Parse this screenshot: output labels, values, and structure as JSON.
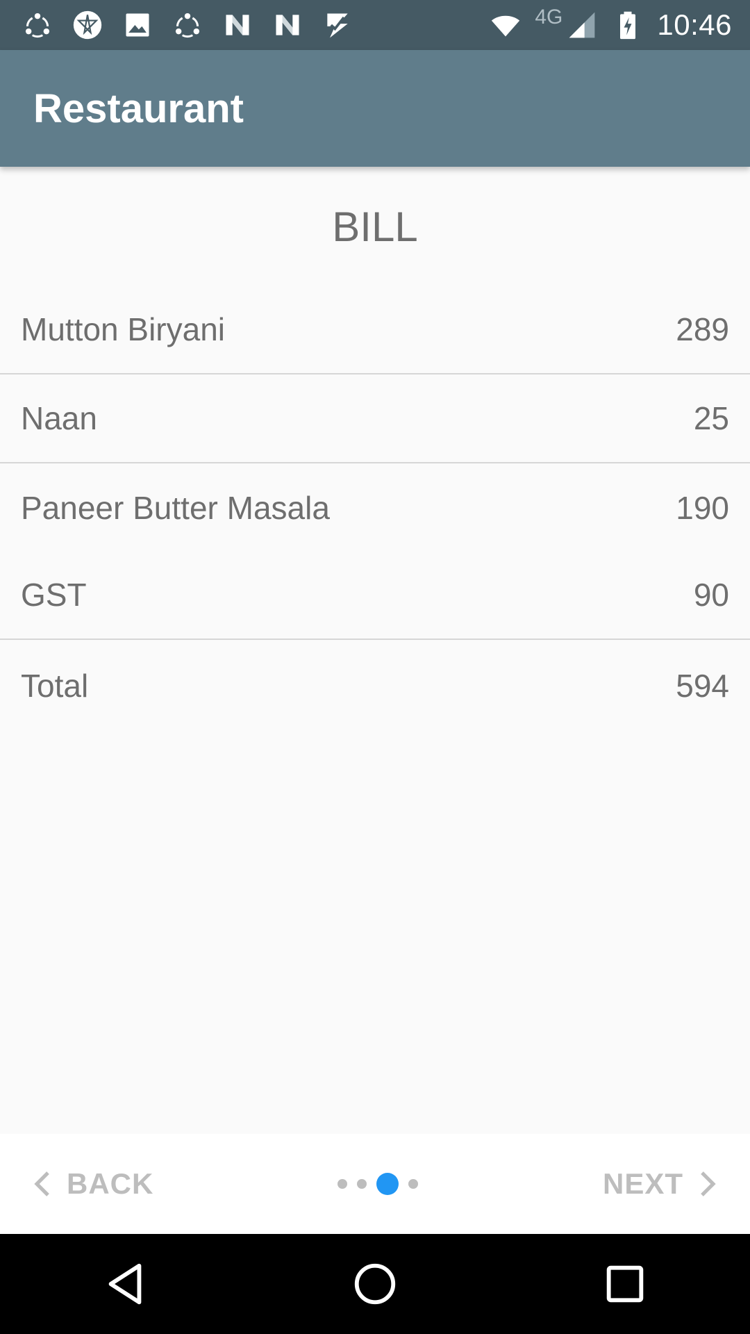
{
  "status_bar": {
    "icons_left": [
      "share-icon",
      "aperture-icon",
      "image-icon",
      "share-icon",
      "n-icon",
      "n-icon",
      "check-icon"
    ],
    "network": "4G",
    "time": "10:46"
  },
  "app_bar": {
    "title": "Restaurant"
  },
  "bill": {
    "title": "BILL",
    "items": [
      {
        "name": "Mutton Biryani",
        "price": "289"
      },
      {
        "name": "Naan",
        "price": "25"
      },
      {
        "name": "Paneer Butter Masala",
        "price": "190"
      },
      {
        "name": "GST",
        "price": "90"
      },
      {
        "name": "Total",
        "price": "594"
      }
    ]
  },
  "bottom_nav": {
    "back_label": "BACK",
    "next_label": "NEXT",
    "page_count": 4,
    "active_page": 3
  },
  "colors": {
    "status_bar": "#455a64",
    "app_bar": "#607d8b",
    "accent": "#2196f3"
  }
}
